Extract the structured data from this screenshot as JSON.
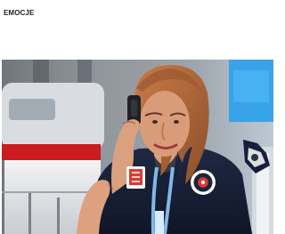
{
  "section": {
    "label": "EMOCJE"
  },
  "photo": {
    "subject": "woman-on-phone",
    "colors": {
      "shirt": "#111b33",
      "hair": "#b86a35",
      "skin": "#d99b78",
      "lanyard": "#7fb7e8",
      "accent_red": "#d9392f",
      "sky_blue": "#39a6e6"
    }
  }
}
